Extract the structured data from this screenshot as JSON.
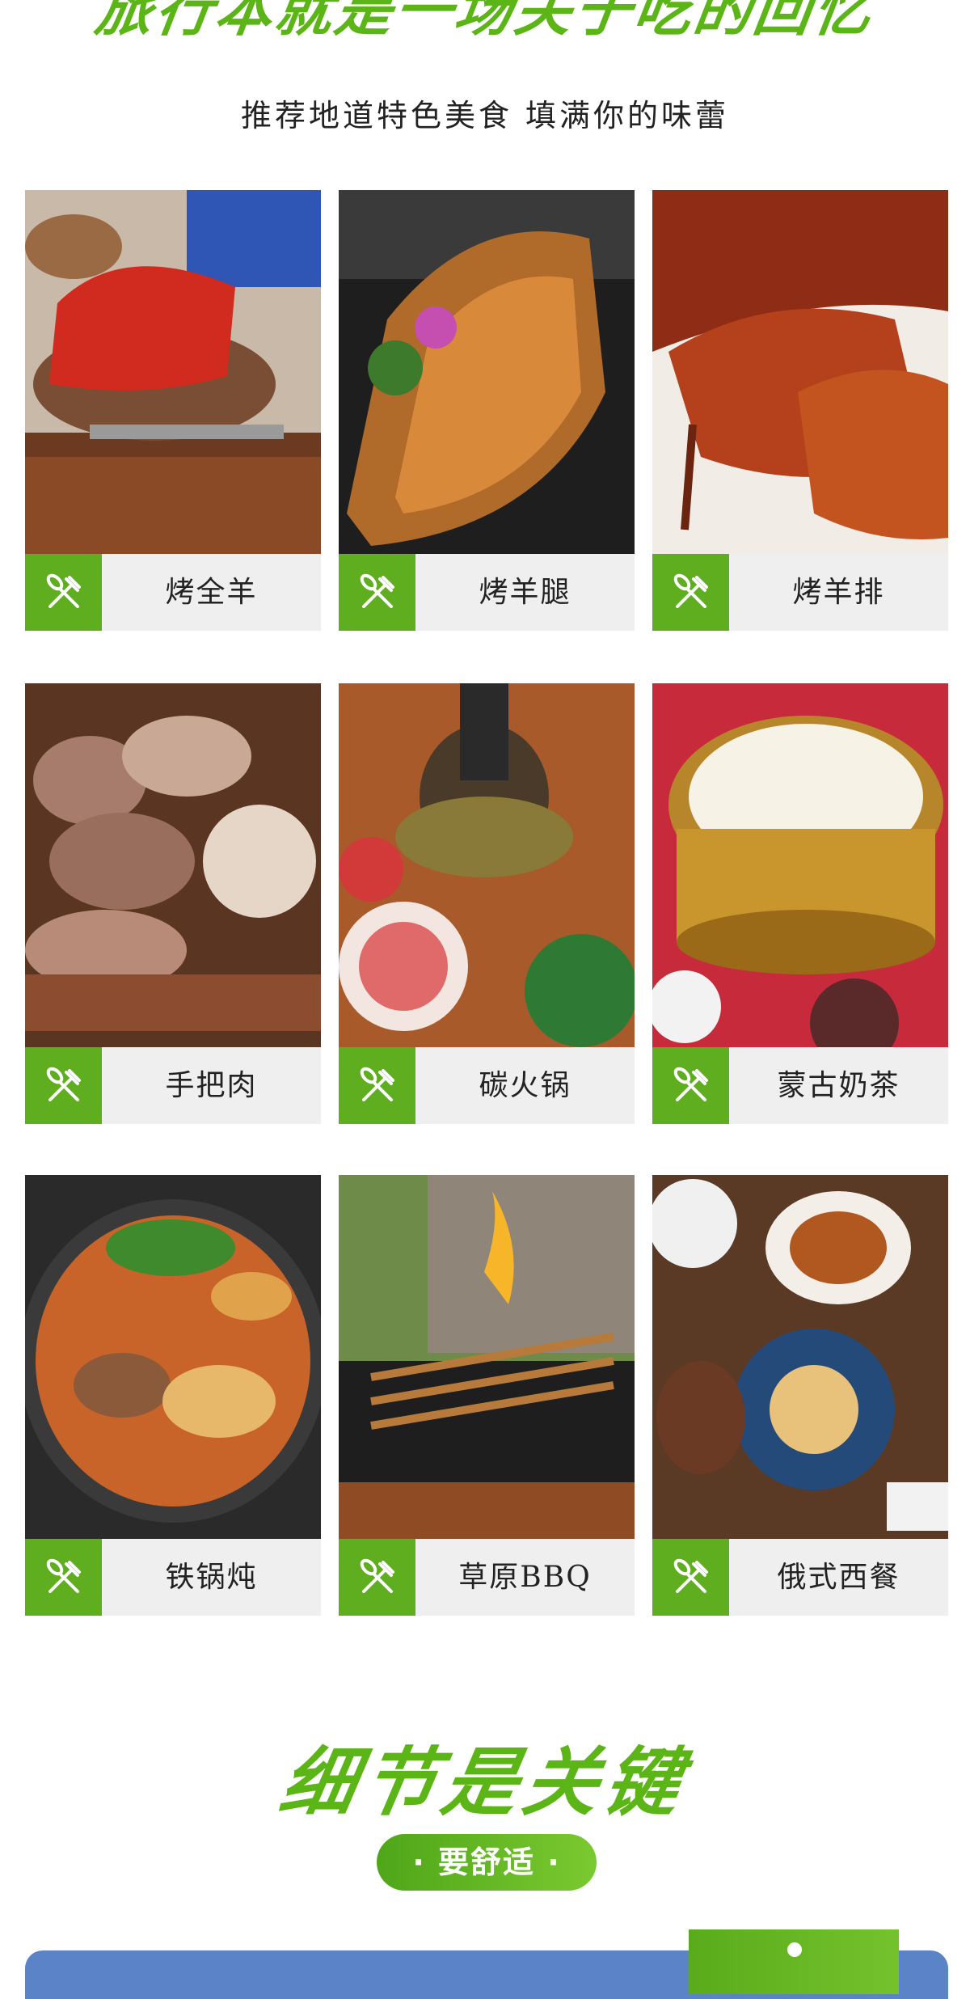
{
  "hero": {
    "title": "旅行本就是一场关于吃的回忆",
    "subtitle": "推荐地道特色美食  填满你的味蕾"
  },
  "foods": [
    {
      "name": "烤全羊",
      "icon": "fork-knife-icon"
    },
    {
      "name": "烤羊腿",
      "icon": "fork-knife-icon"
    },
    {
      "name": "烤羊排",
      "icon": "fork-knife-icon"
    },
    {
      "name": "手把肉",
      "icon": "fork-knife-icon"
    },
    {
      "name": "碳火锅",
      "icon": "fork-knife-icon"
    },
    {
      "name": "蒙古奶茶",
      "icon": "fork-knife-icon"
    },
    {
      "name": "铁锅炖",
      "icon": "fork-knife-icon"
    },
    {
      "name": "草原BBQ",
      "icon": "fork-knife-icon"
    },
    {
      "name": "俄式西餐",
      "icon": "fork-knife-icon"
    }
  ],
  "details": {
    "title": "细节是关键",
    "pill": "· 要舒适 ·"
  },
  "colors": {
    "accent_green": "#5fae1f",
    "label_bg": "#efefef",
    "bottom_blue": "#5a83c8"
  }
}
